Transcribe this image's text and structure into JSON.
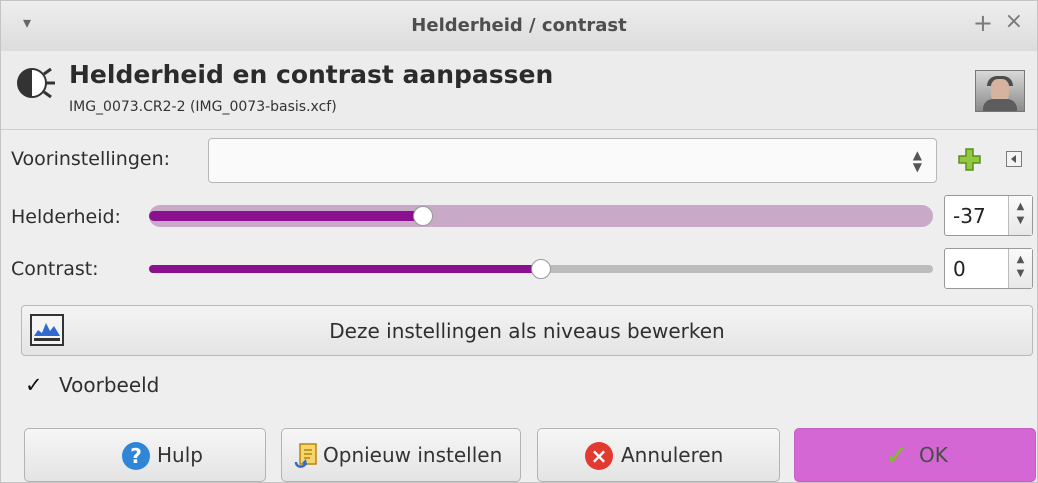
{
  "window": {
    "title": "Helderheid / contrast",
    "menu_symbol": "▾",
    "pin_symbol": "+",
    "close_symbol": "×"
  },
  "header": {
    "title": "Helderheid en contrast aanpassen",
    "subtitle": "IMG_0073.CR2-2 (IMG_0073-basis.xcf)"
  },
  "presets": {
    "label": "Voorinstellingen:",
    "value": "",
    "arrows": "▲\n▼"
  },
  "brightness": {
    "label": "Helderheid:",
    "value": "-37",
    "fraction": 0.35
  },
  "contrast": {
    "label": "Contrast:",
    "value": "0",
    "fraction": 0.5
  },
  "spinner_arrows": "▲\n▼",
  "levels_button": {
    "label": "Deze instellingen als niveaus bewerken"
  },
  "preview": {
    "checkmark": "✓",
    "label": "Voorbeeld"
  },
  "buttons": {
    "help": "Hulp",
    "help_icon": "?",
    "reset": "Opnieuw instellen",
    "cancel": "Annuleren",
    "cancel_icon": "×",
    "ok": "OK",
    "ok_icon": "✓"
  },
  "colors": {
    "accent": "#8b108f",
    "ok_button": "#d467d4"
  }
}
